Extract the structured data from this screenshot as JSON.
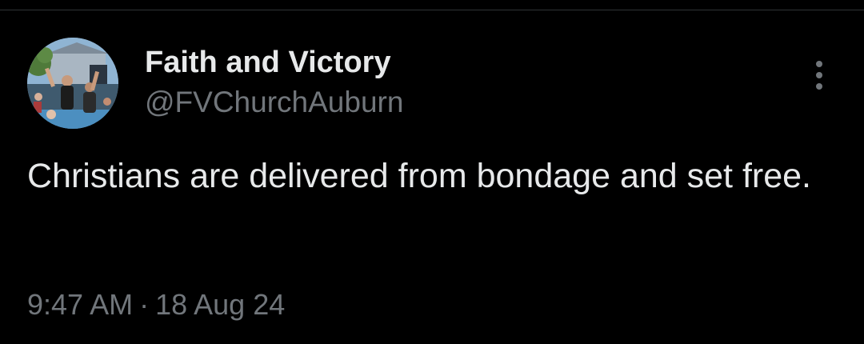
{
  "tweet": {
    "author": {
      "display_name": "Faith and Victory",
      "handle": "@FVChurchAuburn",
      "avatar_icon": "avatar-photo"
    },
    "more_icon": "more-options-icon",
    "text": "Christians are delivered from bondage and set free.",
    "time": "9:47 AM",
    "separator": "·",
    "date": "18 Aug 24"
  },
  "colors": {
    "background": "#000000",
    "primary_text": "#e7e9ea",
    "secondary_text": "#71767b",
    "divider": "#2f3336"
  }
}
